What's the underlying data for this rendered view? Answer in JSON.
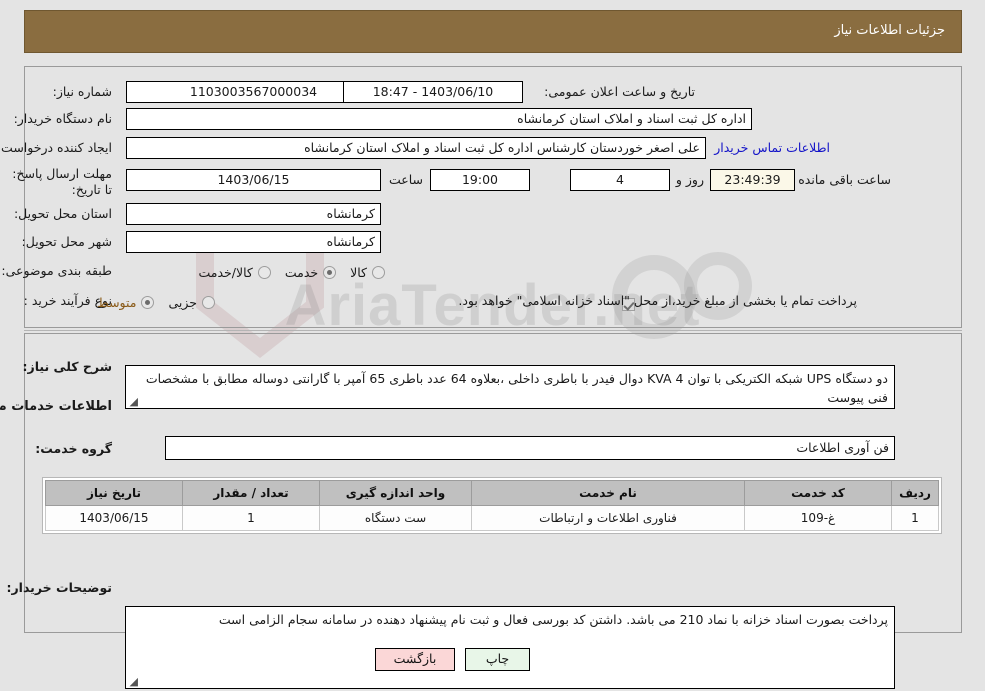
{
  "header": {
    "title": "جزئیات اطلاعات نیاز"
  },
  "fields": {
    "need_number_label": "شماره نیاز:",
    "need_number_value": "1103003567000034",
    "announce_label": "تاریخ و ساعت اعلان عمومی:",
    "announce_value": "1403/06/10 - 18:47",
    "buyer_org_label": "نام دستگاه خریدار:",
    "buyer_org_value": "اداره کل ثبت اسناد و املاک استان کرمانشاه",
    "requester_label": "ایجاد کننده درخواست:",
    "requester_value": "علی اصغر خوردستان کارشناس اداره کل ثبت اسناد و املاک استان کرمانشاه",
    "contact_link": "اطلاعات تماس خریدار",
    "deadline_label": "مهلت ارسال پاسخ: تا تاریخ:",
    "deadline_date": "1403/06/15",
    "deadline_time_label": "ساعت",
    "deadline_time": "19:00",
    "days_value": "4",
    "days_label": "روز و",
    "countdown_value": "23:49:39",
    "countdown_label": "ساعت باقی مانده",
    "province_label": "استان محل تحویل:",
    "province_value": "کرمانشاه",
    "city_label": "شهر محل تحویل:",
    "city_value": "کرمانشاه",
    "classification_label": "طبقه بندی موضوعی:",
    "process_label": "نوع فرآیند خرید :",
    "treasury_note": "پرداخت تمام یا بخشی از مبلغ خرید،از محل \"اسناد خزانه اسلامی\" خواهد بود."
  },
  "classification_options": [
    {
      "label": "کالا",
      "selected": false
    },
    {
      "label": "خدمت",
      "selected": true
    },
    {
      "label": "کالا/خدمت",
      "selected": false
    }
  ],
  "process_options": [
    {
      "label": "جزیی",
      "selected": false
    },
    {
      "label": "متوسط",
      "selected": true
    }
  ],
  "description": {
    "label": "شرح کلی نیاز:",
    "value": "دو دستگاه UPS شبکه الکتریکی با توان KVA 4 دوال فیدر با باطری داخلی ،بعلاوه 64 عدد باطری 65 آمپر با گارانتی دوساله مطابق با مشخصات فنی پیوست"
  },
  "services": {
    "heading": "اطلاعات خدمات مورد نیاز",
    "group_label": "گروه خدمت:",
    "group_value": "فن آوری اطلاعات",
    "columns": [
      "ردیف",
      "کد خدمت",
      "نام خدمت",
      "واحد اندازه گیری",
      "تعداد / مقدار",
      "تاریخ نیاز"
    ],
    "rows": [
      {
        "row": "1",
        "code": "غ-109",
        "name": "فناوری اطلاعات و ارتباطات",
        "unit": "ست دستگاه",
        "quantity": "1",
        "need_date": "1403/06/15"
      }
    ]
  },
  "buyer_notes": {
    "label": "توضیحات خریدار:",
    "value": "پرداخت بصورت اسناد خزانه با نماد 210 می باشد. داشتن کد بورسی فعال و ثبت نام پیشنهاد دهنده در سامانه سجام الزامی است"
  },
  "footer": {
    "print_label": "چاپ",
    "back_label": "بازگشت"
  },
  "watermark": {
    "text": "AriaTender.net"
  },
  "colors": {
    "header_bar": "#8a6d40",
    "link": "#1414c8",
    "selected_radio_text": "#8a5a17",
    "table_header": "#c0c0c0",
    "print_button": "#e8f6e8",
    "back_button": "#fbd7d7",
    "countdown_bg": "#fbf8e8"
  }
}
